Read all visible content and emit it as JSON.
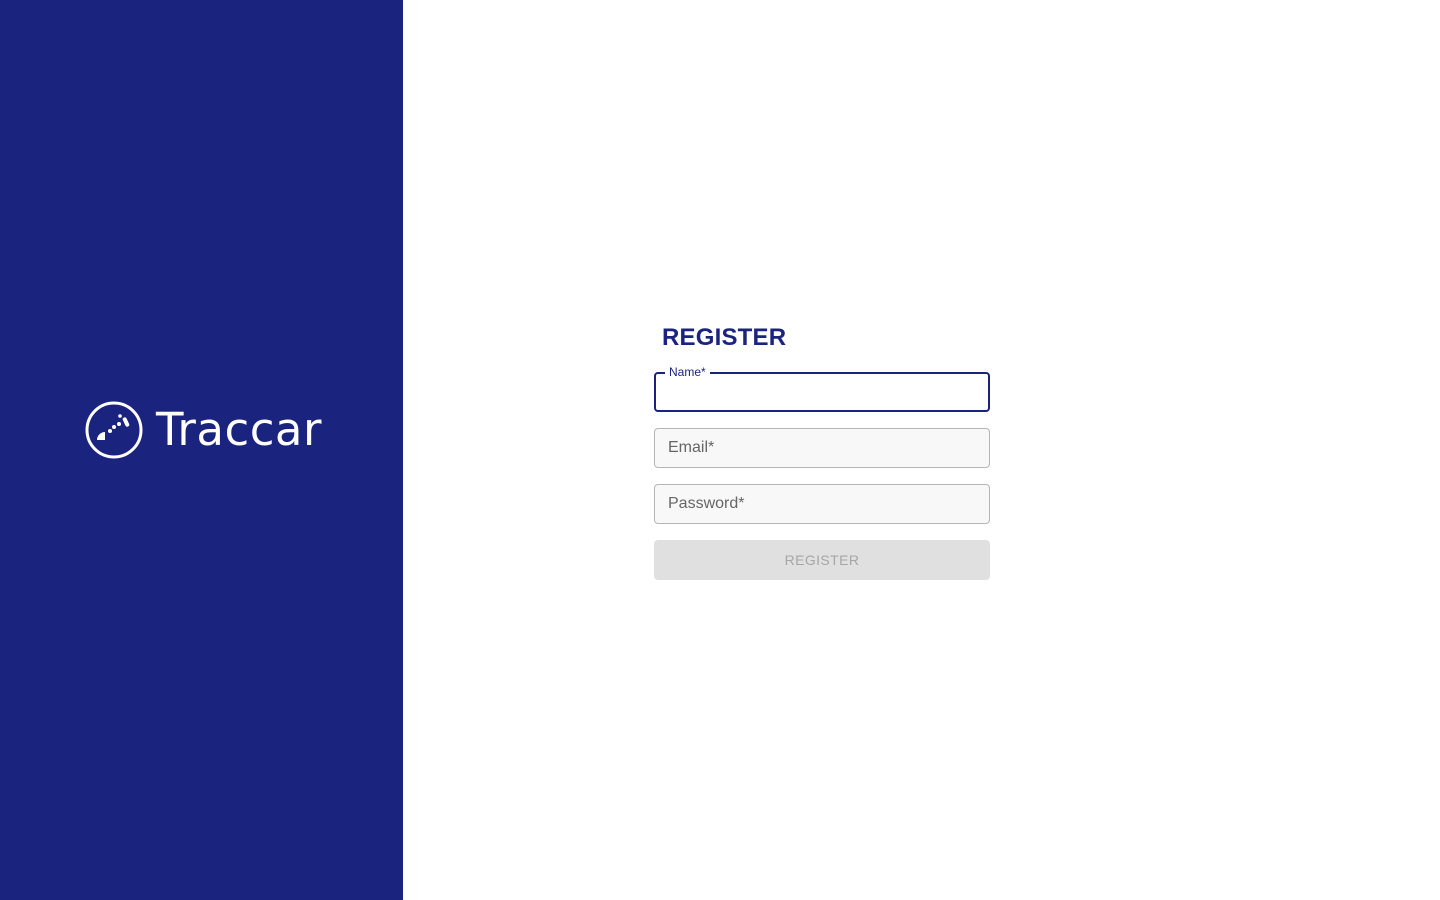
{
  "brand": {
    "name": "Traccar",
    "logo_icon": "traccar-logo-icon"
  },
  "colors": {
    "primary": "#1a237e",
    "background": "#ffffff",
    "button_disabled_bg": "#e0e0e0",
    "button_disabled_text": "#a6a6a6"
  },
  "form": {
    "title": "REGISTER",
    "fields": {
      "name": {
        "label": "Name*",
        "value": "",
        "focused": true
      },
      "email": {
        "label": "Email*",
        "value": ""
      },
      "password": {
        "label": "Password*",
        "value": ""
      }
    },
    "submit": {
      "label": "REGISTER",
      "disabled": true
    }
  }
}
